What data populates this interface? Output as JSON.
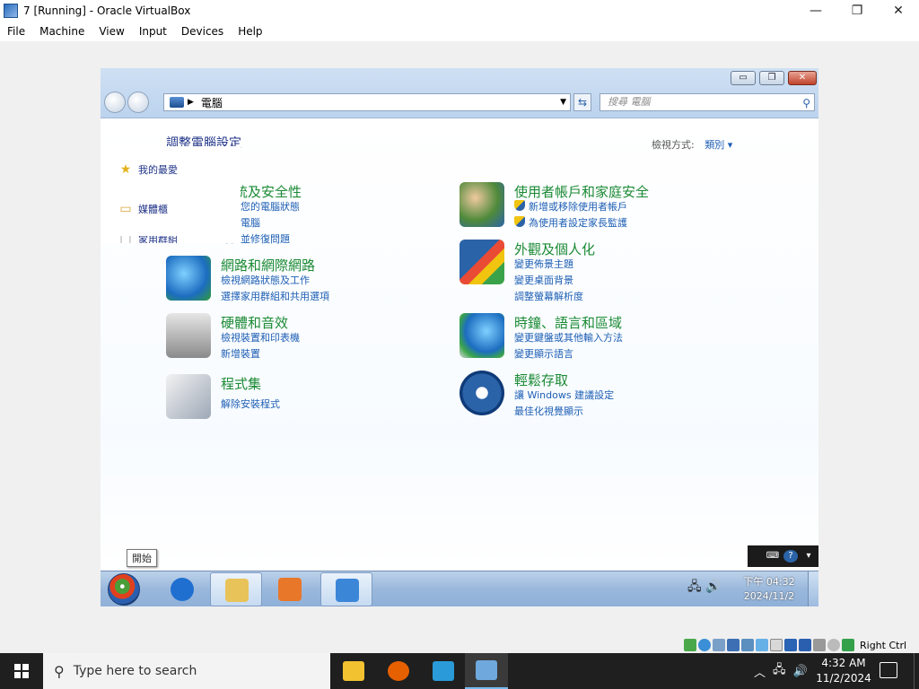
{
  "host": {
    "window_title": "7 [Running] - Oracle VirtualBox",
    "controls": {
      "minimize": "—",
      "maximize": "❐",
      "close": "✕"
    },
    "menu": [
      "File",
      "Machine",
      "View",
      "Input",
      "Devices",
      "Help"
    ]
  },
  "guest": {
    "explorer": {
      "caption_buttons": {
        "minimize": "▭",
        "restore": "❐",
        "close": "✕"
      },
      "address": "電腦",
      "search_placeholder": "搜尋 電腦",
      "page_heading": "調整電腦設定",
      "view_by_label": "檢視方式:",
      "view_by_value": "類別 ▾"
    },
    "favorites_flyout": [
      {
        "label": "我的最愛",
        "icon": "star-icon"
      },
      {
        "label": "媒體櫃",
        "icon": "library-folder-icon"
      },
      {
        "label": "家用群組",
        "icon": "homegroup-icon"
      }
    ],
    "categories": [
      {
        "title": "系統及安全性",
        "links": [
          "檢閱您的電腦狀態",
          "備份電腦",
          "尋找並修復問題"
        ],
        "icon": "system-security-icon"
      },
      {
        "title": "網路和網際網路",
        "links": [
          "檢視網路狀態及工作",
          "選擇家用群組和共用選項"
        ],
        "icon": "network-icon"
      },
      {
        "title": "硬體和音效",
        "links": [
          "檢視裝置和印表機",
          "新增裝置"
        ],
        "icon": "hardware-sound-icon"
      },
      {
        "title": "程式集",
        "links": [
          "解除安裝程式"
        ],
        "icon": "programs-icon"
      },
      {
        "title": "使用者帳戶和家庭安全",
        "links": [
          "新增或移除使用者帳戶",
          "為使用者設定家長監護"
        ],
        "icon": "user-accounts-icon"
      },
      {
        "title": "外觀及個人化",
        "links": [
          "變更佈景主題",
          "變更桌面背景",
          "調整螢幕解析度"
        ],
        "icon": "appearance-icon"
      },
      {
        "title": "時鐘、語言和區域",
        "links": [
          "變更鍵盤或其他輸入方法",
          "變更顯示語言"
        ],
        "icon": "clock-region-icon"
      },
      {
        "title": "輕鬆存取",
        "links": [
          "讓 Windows 建議設定",
          "最佳化視覺顯示"
        ],
        "icon": "ease-of-access-icon"
      }
    ],
    "start_tooltip": "開始",
    "taskbar": {
      "items": [
        {
          "name": "internet-explorer",
          "color": "#1f6fd1",
          "active": false
        },
        {
          "name": "windows-explorer",
          "color": "#e8c35a",
          "active": true
        },
        {
          "name": "media-player",
          "color": "#e8772a",
          "active": false
        },
        {
          "name": "control-panel",
          "color": "#3c86d8",
          "active": true
        }
      ],
      "clock_time": "下午 04:32",
      "clock_date": "2024/11/2"
    }
  },
  "vbox_status": {
    "host_key": "Right Ctrl"
  },
  "host_taskbar": {
    "search_placeholder": "Type here to search",
    "apps": [
      {
        "name": "file-explorer",
        "color": "#f2c230"
      },
      {
        "name": "firefox",
        "color": "#e66000"
      },
      {
        "name": "visual-studio-code",
        "color": "#2a9bd8"
      },
      {
        "name": "virtualbox",
        "color": "#6fa8dc"
      }
    ],
    "time": "4:32 AM",
    "date": "11/2/2024"
  }
}
